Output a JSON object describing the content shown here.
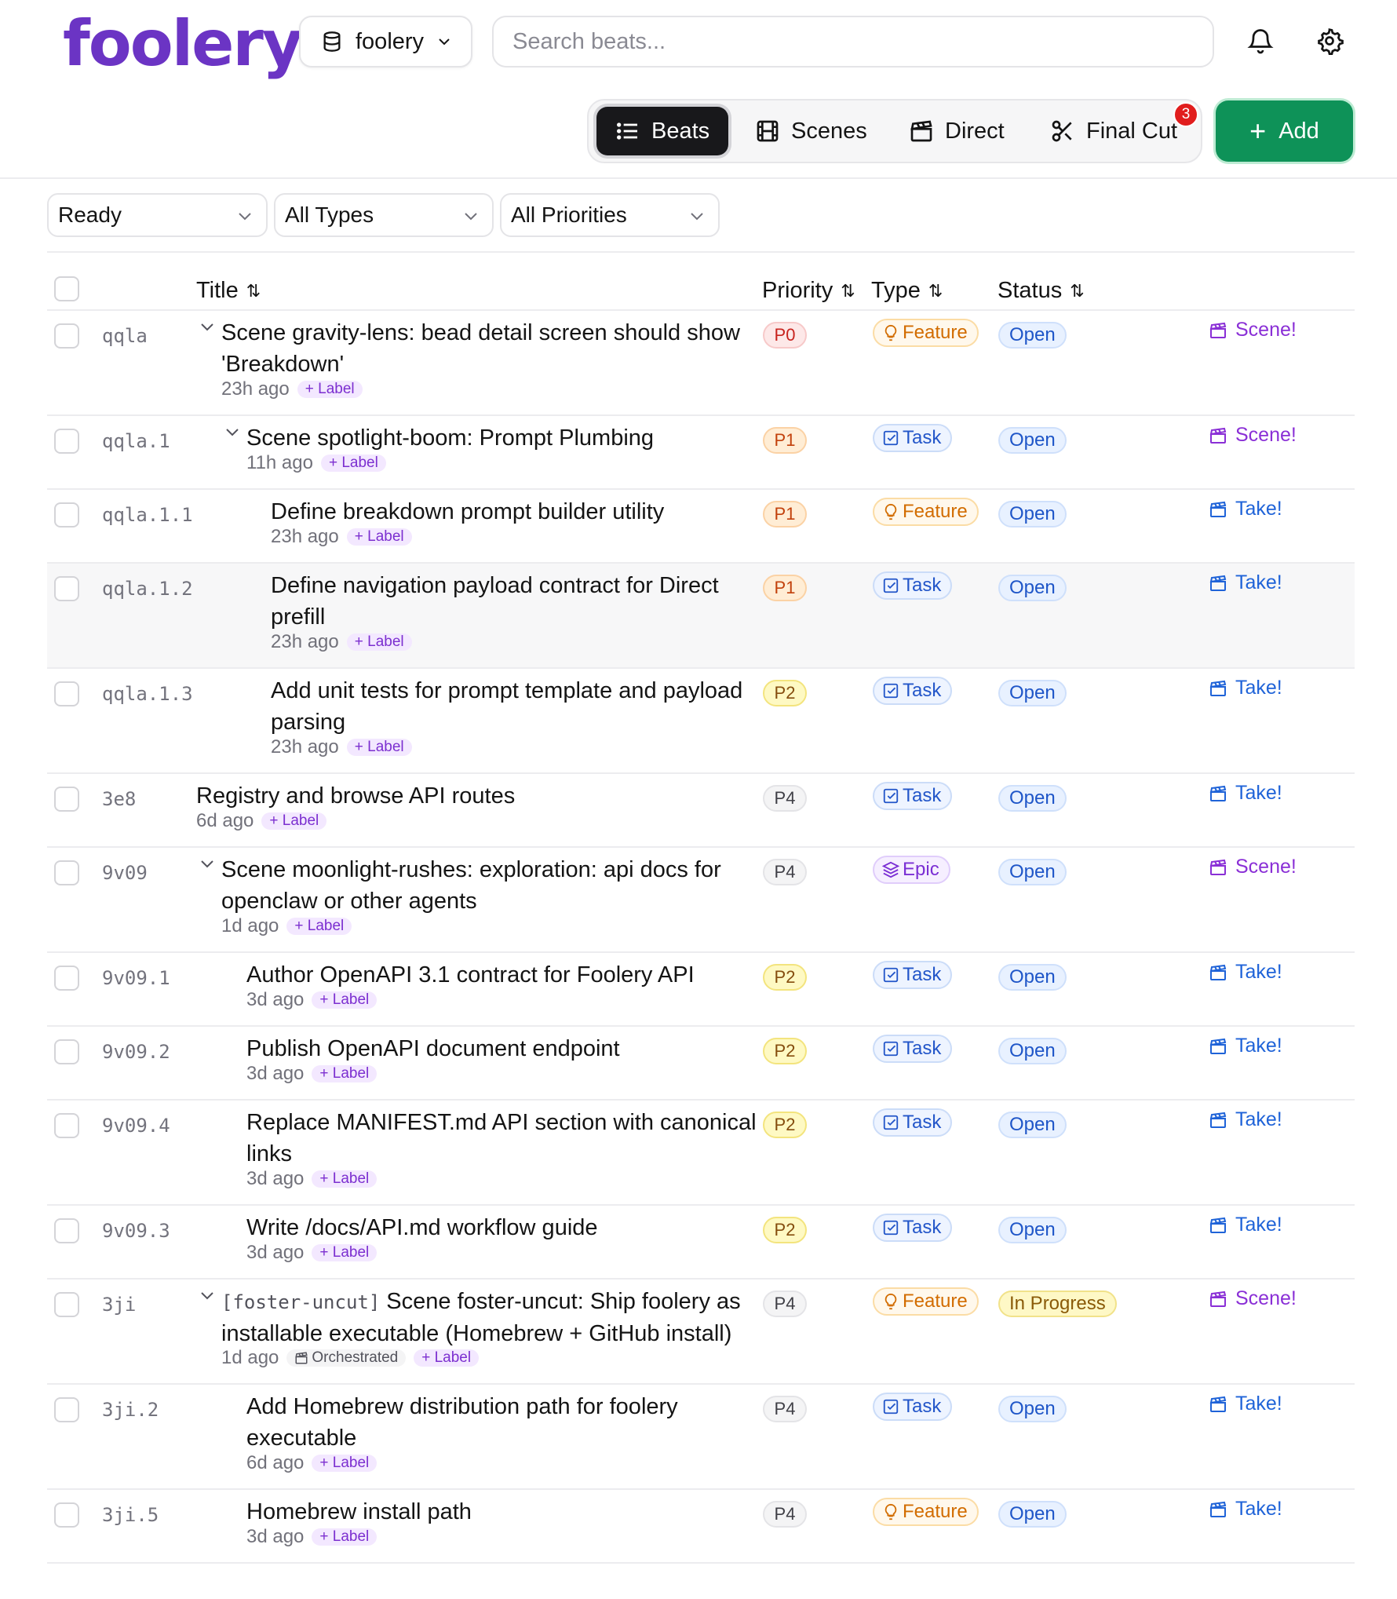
{
  "app": {
    "logo_text": "foolery",
    "brand_color": "#6b34c4",
    "repo_selector": {
      "value": "foolery",
      "icon": "database-icon"
    },
    "search": {
      "placeholder": "Search beats..."
    },
    "notifications_icon": "bell-icon",
    "settings_icon": "gear-icon"
  },
  "nav": {
    "tabs": [
      {
        "label": "Beats",
        "icon": "list-icon",
        "active": true
      },
      {
        "label": "Scenes",
        "icon": "film-icon",
        "active": false
      },
      {
        "label": "Direct",
        "icon": "clapperboard-icon",
        "active": false
      },
      {
        "label": "Final Cut",
        "icon": "scissors-icon",
        "active": false
      }
    ],
    "final_cut_badge": "3",
    "add_label": "Add",
    "add_color": "#0e9258"
  },
  "filters": {
    "state": "Ready",
    "type": "All Types",
    "priority": "All Priorities"
  },
  "table": {
    "columns": {
      "title": "Title",
      "priority": "Priority",
      "type": "Type",
      "status": "Status"
    },
    "sort_glyph": "⇅",
    "rows": [
      {
        "id": "qqla",
        "title": "Scene gravity-lens: bead detail screen should show 'Breakdown'",
        "ago": "23h ago",
        "label": "+ Label",
        "priority": "P0",
        "type": "Feature",
        "status": "Open",
        "action": "Scene!",
        "expandable": true
      },
      {
        "id": "qqla.1",
        "title": "Scene spotlight-boom: Prompt Plumbing",
        "ago": "11h ago",
        "label": "+ Label",
        "priority": "P1",
        "type": "Task",
        "status": "Open",
        "action": "Scene!",
        "expandable": true
      },
      {
        "id": "qqla.1.1",
        "title": "Define breakdown prompt builder utility",
        "ago": "23h ago",
        "label": "+ Label",
        "priority": "P1",
        "type": "Feature",
        "status": "Open",
        "action": "Take!"
      },
      {
        "id": "qqla.1.2",
        "title": "Define navigation payload contract for Direct prefill",
        "ago": "23h ago",
        "label": "+ Label",
        "priority": "P1",
        "type": "Task",
        "status": "Open",
        "action": "Take!"
      },
      {
        "id": "qqla.1.3",
        "title": "Add unit tests for prompt template and payload parsing",
        "ago": "23h ago",
        "label": "+ Label",
        "priority": "P2",
        "type": "Task",
        "status": "Open",
        "action": "Take!"
      },
      {
        "id": "3e8",
        "title": "Registry and browse API routes",
        "ago": "6d ago",
        "label": "+ Label",
        "priority": "P4",
        "type": "Task",
        "status": "Open",
        "action": "Take!"
      },
      {
        "id": "9v09",
        "title": "Scene moonlight-rushes: exploration: api docs for openclaw or other agents",
        "ago": "1d ago",
        "label": "+ Label",
        "priority": "P4",
        "type": "Epic",
        "status": "Open",
        "action": "Scene!",
        "expandable": true
      },
      {
        "id": "9v09.1",
        "title": "Author OpenAPI 3.1 contract for Foolery API",
        "ago": "3d ago",
        "label": "+ Label",
        "priority": "P2",
        "type": "Task",
        "status": "Open",
        "action": "Take!"
      },
      {
        "id": "9v09.2",
        "title": "Publish OpenAPI document endpoint",
        "ago": "3d ago",
        "label": "+ Label",
        "priority": "P2",
        "type": "Task",
        "status": "Open",
        "action": "Take!"
      },
      {
        "id": "9v09.4",
        "title": "Replace MANIFEST.md API section with canonical links",
        "ago": "3d ago",
        "label": "+ Label",
        "priority": "P2",
        "type": "Task",
        "status": "Open",
        "action": "Take!"
      },
      {
        "id": "9v09.3",
        "title": "Write /docs/API.md workflow guide",
        "ago": "3d ago",
        "label": "+ Label",
        "priority": "P2",
        "type": "Task",
        "status": "Open",
        "action": "Take!"
      },
      {
        "id": "3ji",
        "context_tag": "[foster-uncut]",
        "title": "Scene foster-uncut: Ship foolery as installable executable (Homebrew + GitHub install)",
        "ago": "1d ago",
        "orchestrated": "Orchestrated",
        "label": "+ Label",
        "priority": "P4",
        "type": "Feature",
        "status": "In Progress",
        "action": "Scene!",
        "expandable": true
      },
      {
        "id": "3ji.2",
        "title": "Add Homebrew distribution path for foolery executable",
        "ago": "6d ago",
        "label": "+ Label",
        "priority": "P4",
        "type": "Task",
        "status": "Open",
        "action": "Take!"
      },
      {
        "id": "3ji.5",
        "title": "Homebrew install path",
        "ago": "3d ago",
        "label": "+ Label",
        "priority": "P4",
        "type": "Feature",
        "status": "Open",
        "action": "Take!"
      }
    ]
  }
}
